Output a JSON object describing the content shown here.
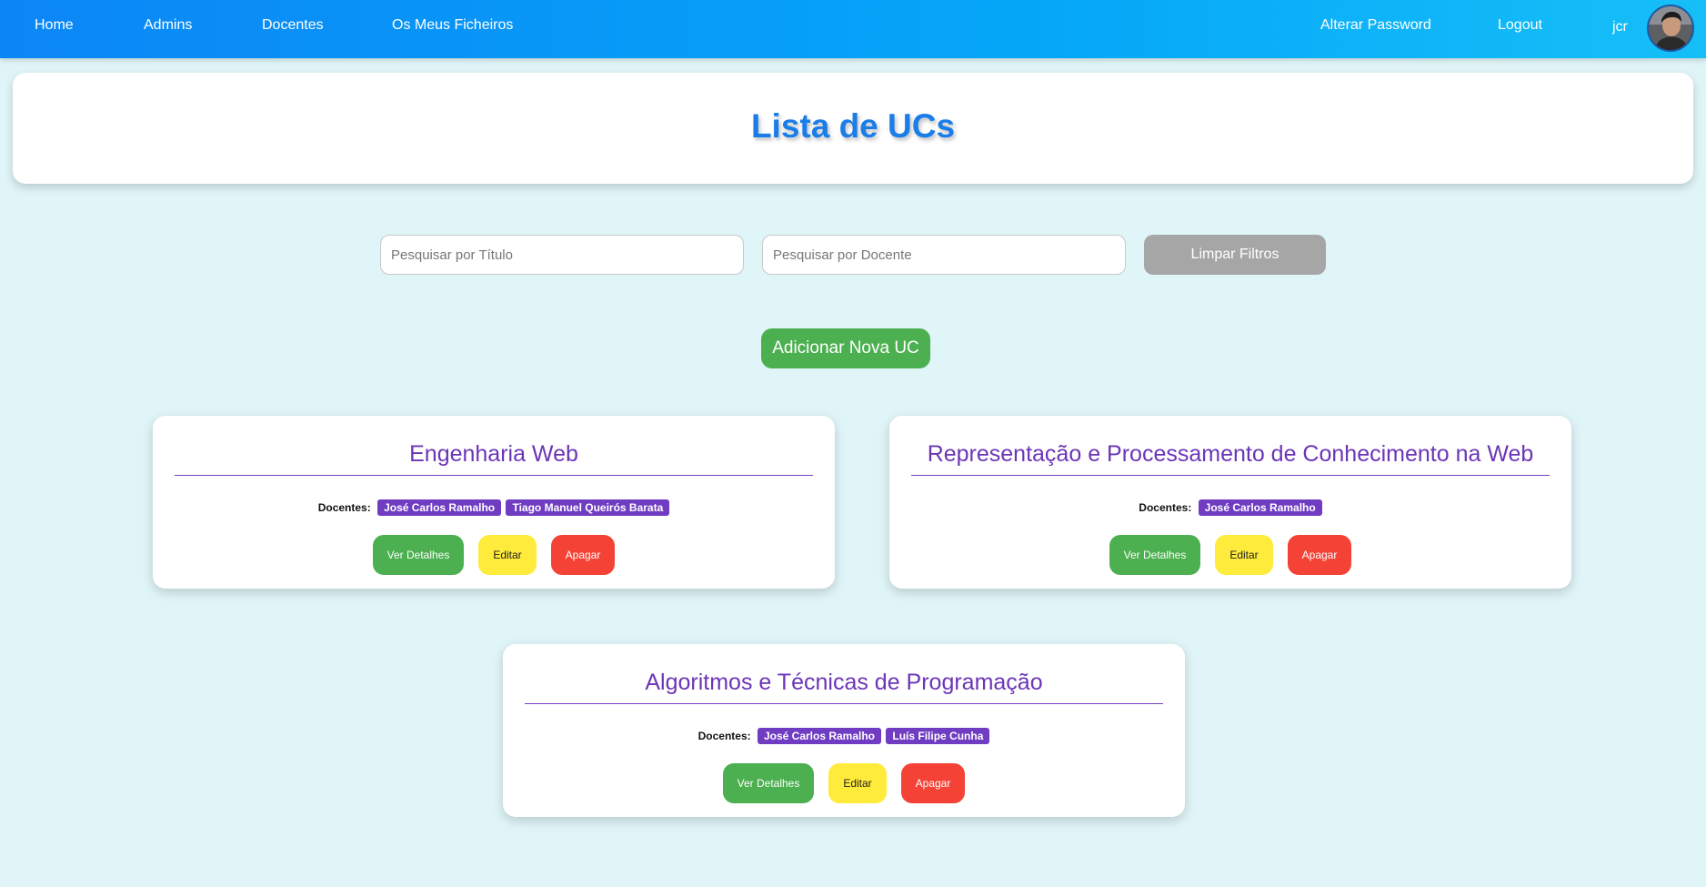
{
  "navbar": {
    "links": [
      "Home",
      "Admins",
      "Docentes",
      "Os Meus Ficheiros"
    ],
    "change_password": "Alterar Password",
    "logout": "Logout",
    "username": "jcr"
  },
  "header": {
    "title": "Lista de UCs"
  },
  "filters": {
    "title_placeholder": "Pesquisar por Título",
    "docente_placeholder": "Pesquisar por Docente",
    "clear_label": "Limpar Filtros"
  },
  "add_button": "Adicionar Nova UC",
  "docentes_label": "Docentes:",
  "actions": {
    "details": "Ver Detalhes",
    "edit": "Editar",
    "delete": "Apagar"
  },
  "ucs": [
    {
      "title": "Engenharia Web",
      "docentes": [
        "José Carlos Ramalho",
        "Tiago Manuel Queirós Barata"
      ]
    },
    {
      "title": "Representação e Processamento de Conhecimento na Web",
      "docentes": [
        "José Carlos Ramalho"
      ]
    },
    {
      "title": "Algoritmos e Técnicas de Programação",
      "docentes": [
        "José Carlos Ramalho",
        "Luís Filipe Cunha"
      ]
    }
  ],
  "colors": {
    "title_blue": "#1a7de8",
    "uc_purple": "#6b35b7",
    "green": "#4caf50",
    "yellow": "#ffeb3b",
    "red": "#f44336",
    "grey": "#a6a6a6"
  }
}
